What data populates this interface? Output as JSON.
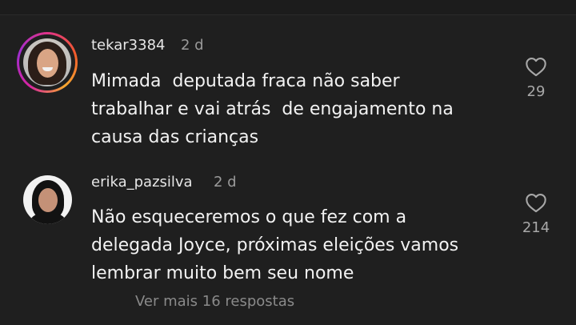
{
  "comments": [
    {
      "username": "tekar3384",
      "time": "2 d",
      "text": "Mimada  deputada fraca não saber\ntrabalhar e vai atrás  de engajamento na\ncausa das crianças",
      "likes": "29",
      "avatar_has_story_ring": true
    },
    {
      "username": "erika_pazsilva",
      "time": "2 d",
      "text": "Não esqueceremos o que fez com a\ndelegada Joyce, próximas eleições vamos\nlembrar muito bem seu nome",
      "likes": "214",
      "avatar_has_story_ring": false
    }
  ],
  "view_more": "Ver mais 16 respostas",
  "icons": {
    "like": "heart-outline-icon"
  },
  "colors": {
    "background": "#1f1f1f",
    "text": "#f2f2f2",
    "muted": "#9a9a9a"
  }
}
